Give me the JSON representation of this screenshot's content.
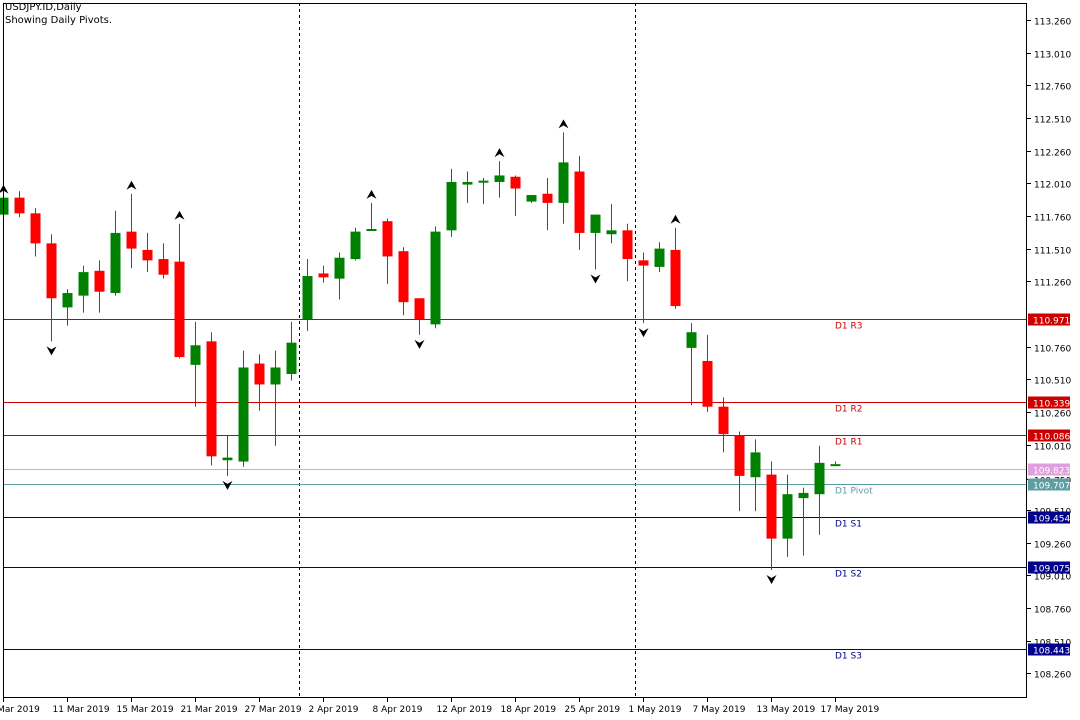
{
  "header": {
    "symbol_line": "USDJPY.ID,Daily",
    "indicator_line": "Showing Daily Pivots."
  },
  "colors": {
    "bull": "#008000",
    "bear": "#ff0000",
    "resistance": "#cc0000",
    "pivot": "#5f9ea0",
    "support": "#00008b",
    "bid": "#dda0dd",
    "fractal": "#000000",
    "period_separator": "#000000"
  },
  "chart_data": {
    "type": "candlestick",
    "title": "USDJPY.ID,Daily",
    "subtitle": "Showing Daily Pivots.",
    "ylim": [
      108.07,
      113.39
    ],
    "y_ticks": [
      "113.260",
      "113.010",
      "112.760",
      "112.510",
      "112.260",
      "112.010",
      "111.760",
      "111.510",
      "111.260",
      "110.760",
      "110.510",
      "110.260",
      "110.010",
      "109.750",
      "109.510",
      "109.260",
      "109.010",
      "108.760",
      "108.510",
      "108.260"
    ],
    "x_labels": [
      "5 Mar 2019",
      "11 Mar 2019",
      "15 Mar 2019",
      "21 Mar 2019",
      "27 Mar 2019",
      "2 Apr 2019",
      "8 Apr 2019",
      "12 Apr 2019",
      "18 Apr 2019",
      "25 Apr 2019",
      "1 May 2019",
      "7 May 2019",
      "13 May 2019",
      "17 May 2019"
    ],
    "x_label_candle_index": [
      0,
      4,
      8,
      12,
      16,
      20,
      24,
      28,
      32,
      36,
      40,
      44,
      48,
      52
    ],
    "period_separators_before_index": [
      19,
      40
    ],
    "candles": [
      {
        "o": 111.77,
        "h": 111.9,
        "l": 111.7,
        "c": 111.9
      },
      {
        "o": 111.9,
        "h": 111.95,
        "l": 111.75,
        "c": 111.78
      },
      {
        "o": 111.78,
        "h": 111.82,
        "l": 111.45,
        "c": 111.55
      },
      {
        "o": 111.55,
        "h": 111.62,
        "l": 110.8,
        "c": 111.13
      },
      {
        "o": 111.06,
        "h": 111.2,
        "l": 110.92,
        "c": 111.17
      },
      {
        "o": 111.15,
        "h": 111.38,
        "l": 111.02,
        "c": 111.33
      },
      {
        "o": 111.34,
        "h": 111.42,
        "l": 111.02,
        "c": 111.18
      },
      {
        "o": 111.17,
        "h": 111.8,
        "l": 111.15,
        "c": 111.63
      },
      {
        "o": 111.64,
        "h": 111.93,
        "l": 111.36,
        "c": 111.51
      },
      {
        "o": 111.5,
        "h": 111.63,
        "l": 111.33,
        "c": 111.42
      },
      {
        "o": 111.43,
        "h": 111.55,
        "l": 111.28,
        "c": 111.31
      },
      {
        "o": 111.41,
        "h": 111.7,
        "l": 110.67,
        "c": 110.68
      },
      {
        "o": 110.62,
        "h": 110.95,
        "l": 110.3,
        "c": 110.77
      },
      {
        "o": 110.8,
        "h": 110.87,
        "l": 109.85,
        "c": 109.92
      },
      {
        "o": 109.89,
        "h": 110.08,
        "l": 109.77,
        "c": 109.91
      },
      {
        "o": 109.88,
        "h": 110.73,
        "l": 109.84,
        "c": 110.6
      },
      {
        "o": 110.63,
        "h": 110.7,
        "l": 110.27,
        "c": 110.47
      },
      {
        "o": 110.47,
        "h": 110.73,
        "l": 110.0,
        "c": 110.6
      },
      {
        "o": 110.55,
        "h": 110.95,
        "l": 110.5,
        "c": 110.79
      },
      {
        "o": 110.97,
        "h": 111.43,
        "l": 110.88,
        "c": 111.3
      },
      {
        "o": 111.32,
        "h": 111.38,
        "l": 111.25,
        "c": 111.29
      },
      {
        "o": 111.28,
        "h": 111.48,
        "l": 111.12,
        "c": 111.44
      },
      {
        "o": 111.43,
        "h": 111.67,
        "l": 111.42,
        "c": 111.64
      },
      {
        "o": 111.65,
        "h": 111.86,
        "l": 111.65,
        "c": 111.66
      },
      {
        "o": 111.72,
        "h": 111.74,
        "l": 111.24,
        "c": 111.45
      },
      {
        "o": 111.49,
        "h": 111.52,
        "l": 111.0,
        "c": 111.1
      },
      {
        "o": 111.13,
        "h": 111.13,
        "l": 110.85,
        "c": 110.97
      },
      {
        "o": 110.93,
        "h": 111.68,
        "l": 110.9,
        "c": 111.64
      },
      {
        "o": 111.65,
        "h": 112.12,
        "l": 111.6,
        "c": 112.02
      },
      {
        "o": 112.0,
        "h": 112.1,
        "l": 111.86,
        "c": 112.02
      },
      {
        "o": 112.02,
        "h": 112.05,
        "l": 111.85,
        "c": 112.03
      },
      {
        "o": 112.02,
        "h": 112.18,
        "l": 111.9,
        "c": 112.07
      },
      {
        "o": 112.06,
        "h": 112.07,
        "l": 111.76,
        "c": 111.97
      },
      {
        "o": 111.87,
        "h": 111.92,
        "l": 111.86,
        "c": 111.92
      },
      {
        "o": 111.93,
        "h": 112.05,
        "l": 111.65,
        "c": 111.86
      },
      {
        "o": 111.86,
        "h": 112.4,
        "l": 111.7,
        "c": 112.17
      },
      {
        "o": 112.1,
        "h": 112.22,
        "l": 111.5,
        "c": 111.63
      },
      {
        "o": 111.63,
        "h": 111.77,
        "l": 111.35,
        "c": 111.77
      },
      {
        "o": 111.62,
        "h": 111.85,
        "l": 111.55,
        "c": 111.65
      },
      {
        "o": 111.65,
        "h": 111.7,
        "l": 111.26,
        "c": 111.43
      },
      {
        "o": 111.42,
        "h": 111.48,
        "l": 110.94,
        "c": 111.38
      },
      {
        "o": 111.37,
        "h": 111.56,
        "l": 111.33,
        "c": 111.51
      },
      {
        "o": 111.5,
        "h": 111.67,
        "l": 111.05,
        "c": 111.07
      },
      {
        "o": 110.75,
        "h": 110.94,
        "l": 110.31,
        "c": 110.87
      },
      {
        "o": 110.65,
        "h": 110.85,
        "l": 110.26,
        "c": 110.3
      },
      {
        "o": 110.3,
        "h": 110.37,
        "l": 109.95,
        "c": 110.09
      },
      {
        "o": 110.08,
        "h": 110.11,
        "l": 109.5,
        "c": 109.77
      },
      {
        "o": 109.76,
        "h": 110.05,
        "l": 109.5,
        "c": 109.95
      },
      {
        "o": 109.78,
        "h": 109.88,
        "l": 109.05,
        "c": 109.29
      },
      {
        "o": 109.29,
        "h": 109.78,
        "l": 109.15,
        "c": 109.63
      },
      {
        "o": 109.6,
        "h": 109.68,
        "l": 109.16,
        "c": 109.64
      },
      {
        "o": 109.63,
        "h": 110.0,
        "l": 109.32,
        "c": 109.87
      },
      {
        "o": 109.86,
        "h": 109.88,
        "l": 109.85,
        "c": 109.86
      }
    ],
    "fractals_up_index": [
      0,
      8,
      11,
      23,
      31,
      35,
      42
    ],
    "fractals_down_index": [
      3,
      14,
      26,
      37,
      40,
      48
    ],
    "pivot_lines": [
      {
        "name": "D1 R3",
        "value": 110.971,
        "label": "110.971",
        "role": "resistance"
      },
      {
        "name": "D1 R2",
        "value": 110.339,
        "label": "110.339",
        "role": "resistance"
      },
      {
        "name": "D1 R1",
        "value": 110.086,
        "label": "110.086",
        "role": "resistance"
      },
      {
        "name": "D1 Pivot",
        "value": 109.707,
        "label": "109.707",
        "role": "pivot"
      },
      {
        "name": "D1 S1",
        "value": 109.454,
        "label": "109.454",
        "role": "support"
      },
      {
        "name": "D1 S2",
        "value": 109.075,
        "label": "109.075",
        "role": "support"
      },
      {
        "name": "D1 S3",
        "value": 108.443,
        "label": "108.443",
        "role": "support"
      }
    ],
    "bid_line": {
      "value": 109.823,
      "label": "109.823"
    },
    "grid": false
  }
}
